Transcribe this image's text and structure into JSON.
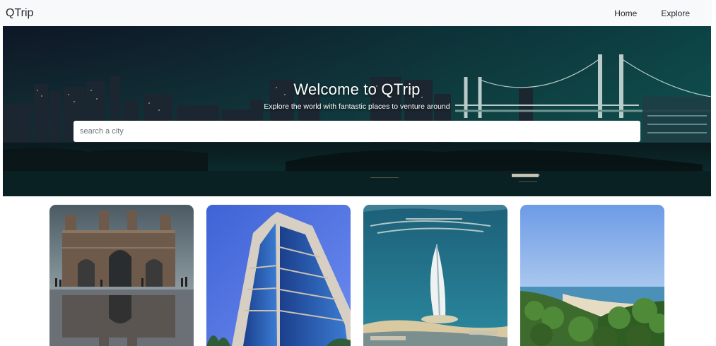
{
  "navbar": {
    "brand": "QTrip",
    "links": [
      {
        "label": "Home"
      },
      {
        "label": "Explore"
      }
    ]
  },
  "hero": {
    "title": "Welcome to QTrip",
    "subtitle": "Explore the world with fantastic places to venture around",
    "search": {
      "placeholder": "search a city",
      "value": ""
    }
  },
  "cards": [
    {
      "image": "gateway-arch-reflection"
    },
    {
      "image": "glass-skyscraper"
    },
    {
      "image": "sail-hotel-island"
    },
    {
      "image": "tropical-coastline"
    }
  ],
  "colors": {
    "navbar_bg": "#f8f9fa",
    "hero_tint": "#0f3b3d",
    "text_dark": "#212529"
  }
}
